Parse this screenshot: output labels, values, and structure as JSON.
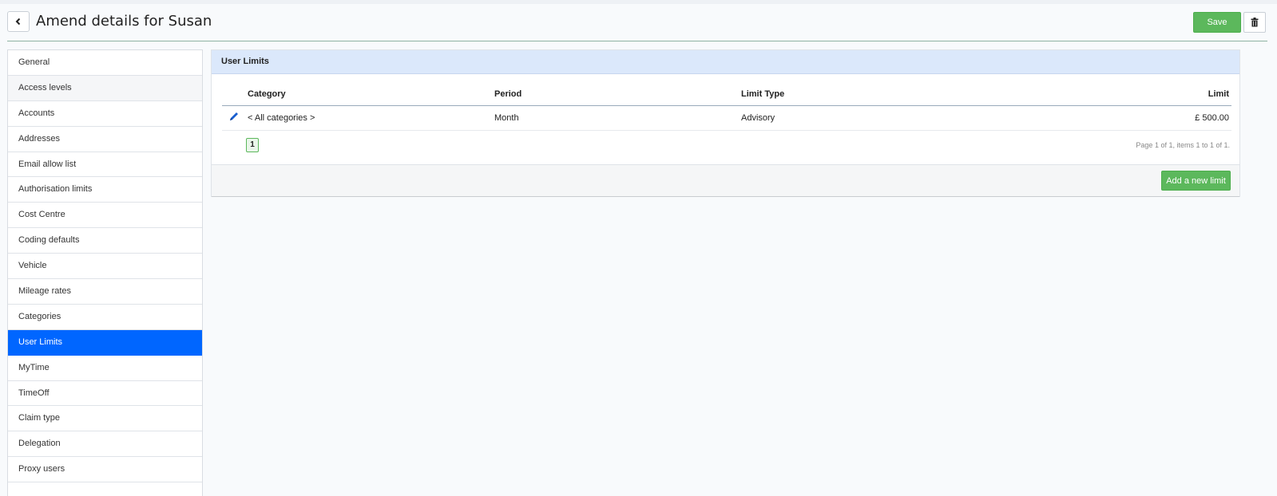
{
  "header": {
    "title": "Amend details for Susan",
    "save_label": "Save"
  },
  "sidebar": {
    "items": [
      {
        "label": "General"
      },
      {
        "label": "Access levels"
      },
      {
        "label": "Accounts"
      },
      {
        "label": "Addresses"
      },
      {
        "label": "Email allow list"
      },
      {
        "label": "Authorisation limits"
      },
      {
        "label": "Cost Centre"
      },
      {
        "label": "Coding defaults"
      },
      {
        "label": "Vehicle"
      },
      {
        "label": "Mileage rates"
      },
      {
        "label": "Categories"
      },
      {
        "label": "User Limits"
      },
      {
        "label": "MyTime"
      },
      {
        "label": "TimeOff"
      },
      {
        "label": "Claim type"
      },
      {
        "label": "Delegation"
      },
      {
        "label": "Proxy users"
      }
    ],
    "active": "User Limits"
  },
  "panel": {
    "title": "User Limits",
    "columns": [
      "Category",
      "Period",
      "Limit Type",
      "Limit"
    ],
    "rows": [
      {
        "category": "< All categories >",
        "period": "Month",
        "limit_type": "Advisory",
        "limit": "£ 500.00"
      }
    ],
    "pager": {
      "current_page": "1",
      "info": "Page 1 of 1, items 1 to 1 of 1."
    },
    "add_label": "Add a new limit"
  },
  "colors": {
    "accent": "#0066ff",
    "save_green": "#5cb85c",
    "panel_header": "#dbe8fb"
  },
  "icons": {
    "back": "chevron-left-icon",
    "delete": "trash-icon",
    "edit": "pencil-icon"
  }
}
